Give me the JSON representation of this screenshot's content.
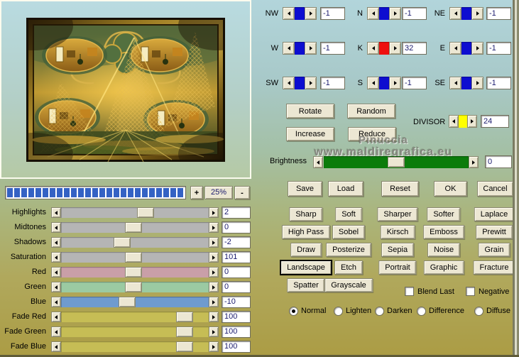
{
  "preview": {
    "zoom_in_label": "+",
    "zoom_level": "25%",
    "zoom_out_label": "-",
    "progress_percent": 100,
    "progress_color": "#3462c4"
  },
  "matrix": {
    "cells": [
      {
        "label": "NW",
        "value": "-1",
        "accent": "#0d0dd0"
      },
      {
        "label": "N",
        "value": "-1",
        "accent": "#0d0dd0"
      },
      {
        "label": "NE",
        "value": "-1",
        "accent": "#0d0dd0"
      },
      {
        "label": "W",
        "value": "-1",
        "accent": "#0d0dd0"
      },
      {
        "label": "K",
        "value": "32",
        "accent": "#ee0f0f"
      },
      {
        "label": "E",
        "value": "-1",
        "accent": "#0d0dd0"
      },
      {
        "label": "SW",
        "value": "-1",
        "accent": "#0d0dd0"
      },
      {
        "label": "S",
        "value": "-1",
        "accent": "#0d0dd0"
      },
      {
        "label": "SE",
        "value": "-1",
        "accent": "#0d0dd0"
      }
    ],
    "divisor": {
      "label": "DIVISOR",
      "value": "24",
      "accent": "#ffff00"
    }
  },
  "matrix_actions": {
    "rotate": "Rotate",
    "random": "Random",
    "increase": "Increase",
    "reduce": "Reduce"
  },
  "brightness": {
    "label": "Brightness",
    "value": "0",
    "track_color": "#0b7c0b",
    "thumb_pos": 0.5
  },
  "dialog_buttons": [
    "Save",
    "Load",
    "Reset",
    "OK",
    "Cancel"
  ],
  "presets": {
    "rows": [
      [
        "Sharp",
        "Soft",
        "Sharper",
        "Softer",
        "Laplace"
      ],
      [
        "High Pass",
        "Sobel",
        "Kirsch",
        "Emboss",
        "Prewitt"
      ],
      [
        "Draw",
        "Posterize",
        "Sepia",
        "Noise",
        "Grain"
      ],
      [
        "Landscape",
        "Etch",
        "Portrait",
        "Graphic",
        "Fracture"
      ],
      [
        "Spatter",
        "Grayscale"
      ]
    ],
    "selected": "Landscape"
  },
  "toggles": [
    {
      "label": "Blend Last",
      "checked": false
    },
    {
      "label": "Negative",
      "checked": false
    }
  ],
  "blend_modes": {
    "options": [
      "Normal",
      "Lighten",
      "Darken",
      "Difference",
      "Diffuse"
    ],
    "selected": "Normal"
  },
  "sliders": [
    {
      "label": "Highlights",
      "value": "2",
      "track": "#b5b5b5",
      "pos": 0.58
    },
    {
      "label": "Midtones",
      "value": "0",
      "track": "#b5b5b5",
      "pos": 0.49
    },
    {
      "label": "Shadows",
      "value": "-2",
      "track": "#b5b5b5",
      "pos": 0.4
    },
    {
      "label": "Saturation",
      "value": "101",
      "track": "#b5b5b5",
      "pos": 0.49
    },
    {
      "label": "Red",
      "value": "0",
      "track": "#c99fa8",
      "pos": 0.49
    },
    {
      "label": "Green",
      "value": "0",
      "track": "#9bcaa2",
      "pos": 0.49
    },
    {
      "label": "Blue",
      "value": "-10",
      "track": "#6f9bce",
      "pos": 0.44
    },
    {
      "label": "Fade Red",
      "value": "100",
      "track": "#c6bd55",
      "pos": 0.88
    },
    {
      "label": "Fade Green",
      "value": "100",
      "track": "#c6bd55",
      "pos": 0.88
    },
    {
      "label": "Fade Blue",
      "value": "100",
      "track": "#c6bd55",
      "pos": 0.88
    }
  ],
  "watermark": {
    "line1": "Pinuccia",
    "line2": "www.maldiregrafica.eu"
  }
}
